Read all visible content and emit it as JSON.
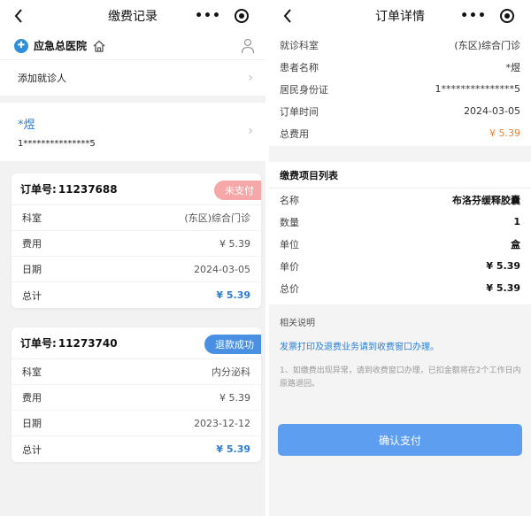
{
  "left": {
    "nav": {
      "title": "缴费记录",
      "dots": "•••"
    },
    "hospital": {
      "logo_text": "✚",
      "name": "应急总医院"
    },
    "add_patient": {
      "label": "添加就诊人"
    },
    "patient": {
      "name": "*煜",
      "id": "1***************5"
    },
    "orders": [
      {
        "order_label": "订单号:",
        "order_no": "11237688",
        "status": "未支付",
        "rows": [
          {
            "label": "科室",
            "value": "(东区)综合门诊"
          },
          {
            "label": "费用",
            "value": "¥ 5.39"
          },
          {
            "label": "日期",
            "value": "2024-03-05"
          },
          {
            "label": "总计",
            "value": "¥ 5.39"
          }
        ]
      },
      {
        "order_label": "订单号:",
        "order_no": "11273740",
        "status": "退款成功",
        "rows": [
          {
            "label": "科室",
            "value": "内分泌科"
          },
          {
            "label": "费用",
            "value": "¥ 5.39"
          },
          {
            "label": "日期",
            "value": "2023-12-12"
          },
          {
            "label": "总计",
            "value": "¥ 5.39"
          }
        ]
      }
    ]
  },
  "right": {
    "nav": {
      "title": "订单详情",
      "dots": "•••"
    },
    "info": [
      {
        "label": "就诊科室",
        "value": "(东区)综合门诊"
      },
      {
        "label": "患者名称",
        "value": "*煜"
      },
      {
        "label": "居民身份证",
        "value": "1***************5"
      },
      {
        "label": "订单时间",
        "value": "2024-03-05"
      },
      {
        "label": "总费用",
        "value": "¥ 5.39"
      }
    ],
    "items": {
      "title": "缴费项目列表",
      "rows": [
        {
          "label": "名称",
          "value": "布洛芬缓释胶囊"
        },
        {
          "label": "数量",
          "value": "1"
        },
        {
          "label": "单位",
          "value": "盒"
        },
        {
          "label": "单价",
          "value": "¥ 5.39"
        },
        {
          "label": "总价",
          "value": "¥ 5.39"
        }
      ]
    },
    "notes": {
      "title": "相关说明",
      "link": "发票打印及退费业务请到收费窗口办理。",
      "text": "1、如缴费出现异常，请到收费窗口办理，已扣金额将在2个工作日内原路退回。"
    },
    "confirm_label": "确认支付"
  },
  "colors": {
    "accent_blue": "#2b7cd3",
    "button_blue": "#5e9ef0",
    "unpaid_tag": "#f6a8a8",
    "refund_tag": "#4a90e2",
    "fee_orange": "#e3843a"
  }
}
